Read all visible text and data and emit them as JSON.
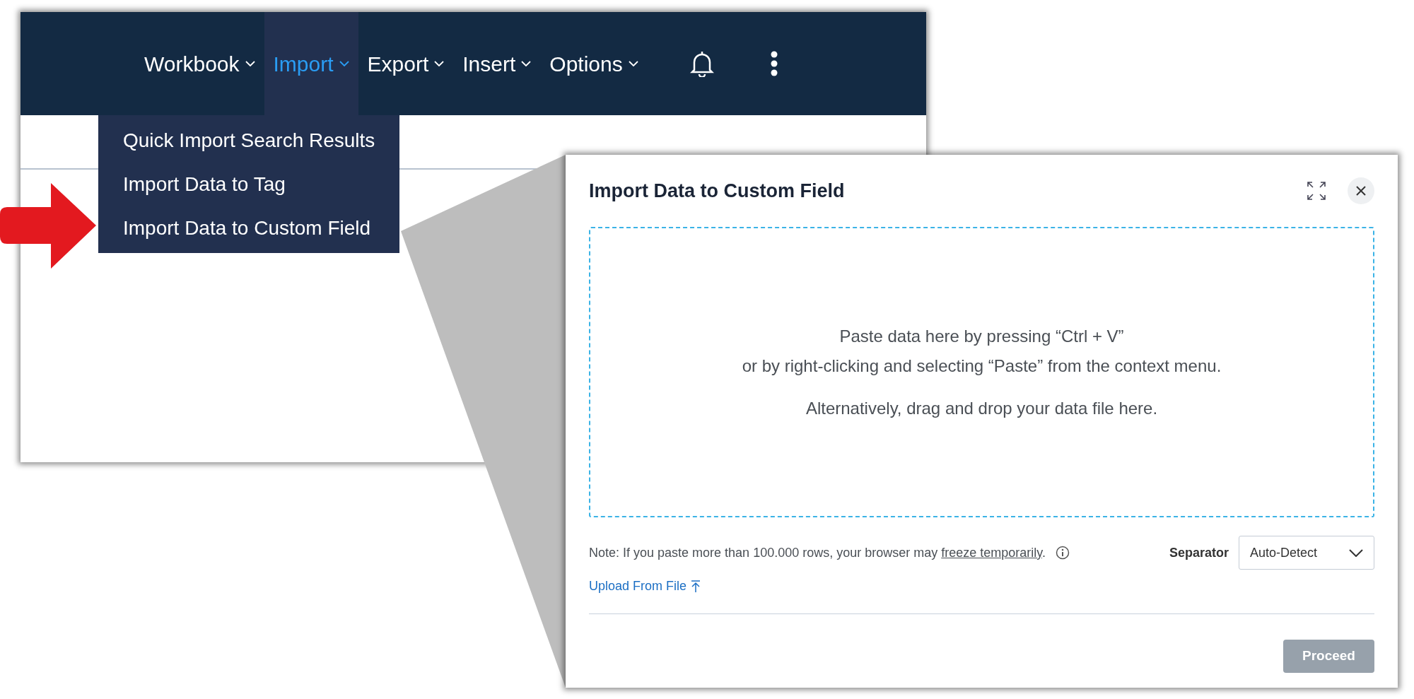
{
  "nav": {
    "items": [
      {
        "label": "Workbook",
        "selected": false
      },
      {
        "label": "Import",
        "selected": true
      },
      {
        "label": "Export",
        "selected": false
      },
      {
        "label": "Insert",
        "selected": false
      },
      {
        "label": "Options",
        "selected": false
      }
    ]
  },
  "import_menu": {
    "items": [
      "Quick Import Search Results",
      "Import Data to Tag",
      "Import Data to Custom Field"
    ]
  },
  "dialog": {
    "title": "Import Data to Custom Field",
    "dropzone": {
      "paragraphs": [
        [
          "Paste data here by pressing “Ctrl + V”",
          "or by right-clicking and selecting “Paste” from the context menu."
        ],
        [
          "Alternatively, drag and drop your data file here."
        ]
      ]
    },
    "note": {
      "before": "Note: If you paste more than 100.000 rows, your browser may ",
      "link": "freeze temporarily",
      "after": "."
    },
    "separator": {
      "label": "Separator",
      "value": "Auto-Detect"
    },
    "upload_link": "Upload From File",
    "proceed": {
      "label": "Proceed",
      "disabled": true
    }
  }
}
